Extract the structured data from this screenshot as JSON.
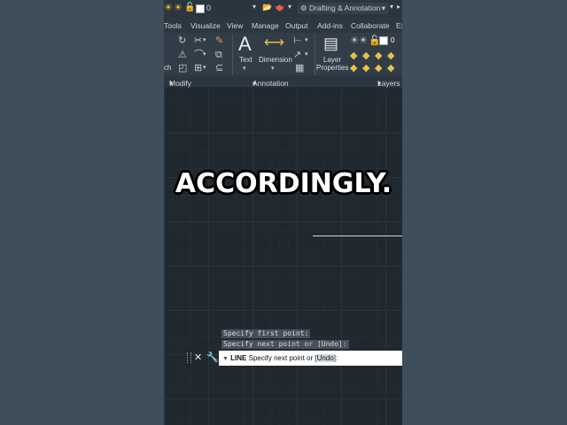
{
  "qat": {
    "layer_name": "0",
    "workspace": "Drafting & Annotation"
  },
  "tabs": [
    "Tools",
    "Visualize",
    "View",
    "Manage",
    "Output",
    "Add-ins",
    "Collaborate",
    "Ex"
  ],
  "ribbon": {
    "modify_stub_label": "ch",
    "text_label": "Text",
    "dimension_label": "Dimension",
    "layer_properties_label_1": "Layer",
    "layer_properties_label_2": "Properties",
    "layer_value": "0"
  },
  "panels": {
    "modify": "Modify",
    "annotation": "Annotation",
    "layers": "Layers"
  },
  "caption": "ACCORDINGLY.",
  "command_history": [
    "Specify first point:",
    "Specify next point or [Undo]:"
  ],
  "command_line": {
    "command": "LINE",
    "prompt_before": "Specify next point or [",
    "option": "Undo",
    "prompt_after": "]:"
  }
}
